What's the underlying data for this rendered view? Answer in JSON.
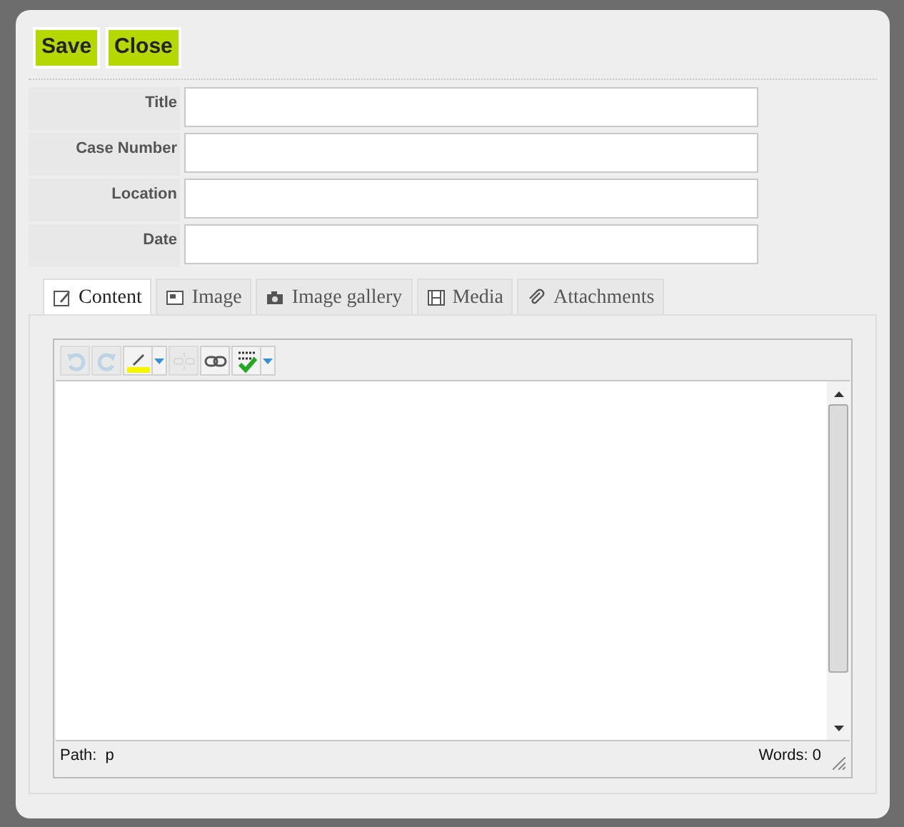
{
  "actions": [
    {
      "label": "Save"
    },
    {
      "label": "Close"
    }
  ],
  "fields": [
    {
      "label": "Title"
    },
    {
      "label": "Case Number"
    },
    {
      "label": "Location"
    },
    {
      "label": "Date"
    }
  ],
  "tabs": [
    {
      "label": "Content",
      "kind": "edit",
      "selected": true
    },
    {
      "label": "Image",
      "kind": "image",
      "selected": false
    },
    {
      "label": "Image gallery",
      "kind": "camera",
      "selected": false
    },
    {
      "label": "Media",
      "kind": "film",
      "selected": false
    },
    {
      "label": "Attachments",
      "kind": "clip",
      "selected": false
    }
  ],
  "editor": {
    "tools": [
      {
        "kind": "undo",
        "disabled": true,
        "dropdown": false
      },
      {
        "kind": "redo",
        "disabled": true,
        "dropdown": false
      },
      {
        "kind": "highlight",
        "disabled": false,
        "dropdown": true
      },
      {
        "kind": "unlink",
        "disabled": true,
        "dropdown": false
      },
      {
        "kind": "link",
        "disabled": false,
        "dropdown": false
      },
      {
        "kind": "spellcheck",
        "disabled": false,
        "dropdown": true
      }
    ],
    "status": {
      "path_label": "Path:",
      "path": "p",
      "words": "Words: 0"
    }
  }
}
